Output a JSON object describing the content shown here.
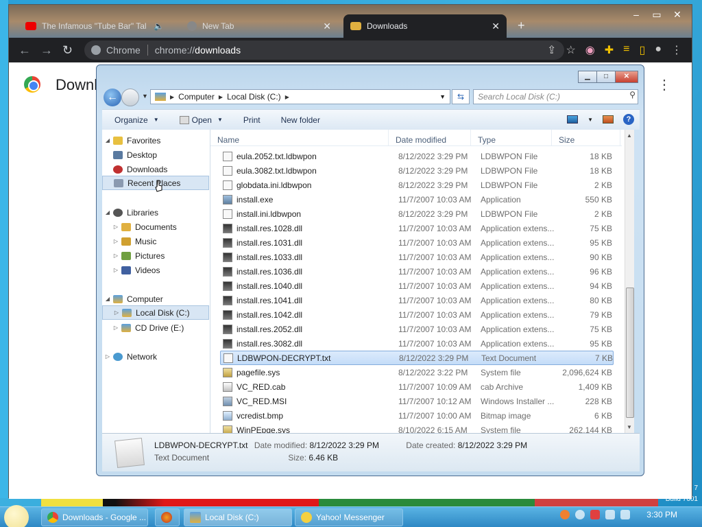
{
  "desktop": {
    "corner_text_1": "7",
    "corner_text_2": "Build 7601"
  },
  "chrome": {
    "tabs": [
      {
        "label": "The Infamous \"Tube Bar\" Tal",
        "active": false
      },
      {
        "label": "New Tab",
        "active": false
      },
      {
        "label": "Downloads",
        "active": true
      }
    ],
    "omnibox": {
      "site": "Chrome",
      "scheme": "chrome://",
      "path": "downloads"
    },
    "page_title": "Downl",
    "more_icon": "⋮"
  },
  "explorer": {
    "breadcrumb": [
      "Computer",
      "Local Disk (C:)"
    ],
    "search_placeholder": "Search Local Disk (C:)",
    "commands": {
      "organize": "Organize",
      "open": "Open",
      "print": "Print",
      "new_folder": "New folder"
    },
    "nav": {
      "favorites": "Favorites",
      "desktop": "Desktop",
      "downloads": "Downloads",
      "recent": "Recent Places",
      "libraries": "Libraries",
      "documents": "Documents",
      "music": "Music",
      "pictures": "Pictures",
      "videos": "Videos",
      "computer": "Computer",
      "local_disk": "Local Disk (C:)",
      "cd_drive": "CD Drive (E:)",
      "network": "Network"
    },
    "columns": {
      "name": "Name",
      "date": "Date modified",
      "type": "Type",
      "size": "Size"
    },
    "files": [
      {
        "name": "eula.2052.txt.ldbwpon",
        "date": "8/12/2022 3:29 PM",
        "type": "LDBWPON File",
        "size": "18 KB"
      },
      {
        "name": "eula.3082.txt.ldbwpon",
        "date": "8/12/2022 3:29 PM",
        "type": "LDBWPON File",
        "size": "18 KB"
      },
      {
        "name": "globdata.ini.ldbwpon",
        "date": "8/12/2022 3:29 PM",
        "type": "LDBWPON File",
        "size": "2 KB"
      },
      {
        "name": "install.exe",
        "date": "11/7/2007 10:03 AM",
        "type": "Application",
        "size": "550 KB"
      },
      {
        "name": "install.ini.ldbwpon",
        "date": "8/12/2022 3:29 PM",
        "type": "LDBWPON File",
        "size": "2 KB"
      },
      {
        "name": "install.res.1028.dll",
        "date": "11/7/2007 10:03 AM",
        "type": "Application extens...",
        "size": "75 KB"
      },
      {
        "name": "install.res.1031.dll",
        "date": "11/7/2007 10:03 AM",
        "type": "Application extens...",
        "size": "95 KB"
      },
      {
        "name": "install.res.1033.dll",
        "date": "11/7/2007 10:03 AM",
        "type": "Application extens...",
        "size": "90 KB"
      },
      {
        "name": "install.res.1036.dll",
        "date": "11/7/2007 10:03 AM",
        "type": "Application extens...",
        "size": "96 KB"
      },
      {
        "name": "install.res.1040.dll",
        "date": "11/7/2007 10:03 AM",
        "type": "Application extens...",
        "size": "94 KB"
      },
      {
        "name": "install.res.1041.dll",
        "date": "11/7/2007 10:03 AM",
        "type": "Application extens...",
        "size": "80 KB"
      },
      {
        "name": "install.res.1042.dll",
        "date": "11/7/2007 10:03 AM",
        "type": "Application extens...",
        "size": "79 KB"
      },
      {
        "name": "install.res.2052.dll",
        "date": "11/7/2007 10:03 AM",
        "type": "Application extens...",
        "size": "75 KB"
      },
      {
        "name": "install.res.3082.dll",
        "date": "11/7/2007 10:03 AM",
        "type": "Application extens...",
        "size": "95 KB"
      },
      {
        "name": "LDBWPON-DECRYPT.txt",
        "date": "8/12/2022 3:29 PM",
        "type": "Text Document",
        "size": "7 KB",
        "selected": true
      },
      {
        "name": "pagefile.sys",
        "date": "8/12/2022 3:22 PM",
        "type": "System file",
        "size": "2,096,624 KB"
      },
      {
        "name": "VC_RED.cab",
        "date": "11/7/2007 10:09 AM",
        "type": "cab Archive",
        "size": "1,409 KB"
      },
      {
        "name": "VC_RED.MSI",
        "date": "11/7/2007 10:12 AM",
        "type": "Windows Installer ...",
        "size": "228 KB"
      },
      {
        "name": "vcredist.bmp",
        "date": "11/7/2007 10:00 AM",
        "type": "Bitmap image",
        "size": "6 KB"
      },
      {
        "name": "WinPEpge.sys",
        "date": "8/10/2022 6:15 AM",
        "type": "System file",
        "size": "262,144 KB"
      }
    ],
    "details": {
      "name": "LDBWPON-DECRYPT.txt",
      "type": "Text Document",
      "modified_label": "Date modified:",
      "modified": "8/12/2022 3:29 PM",
      "created_label": "Date created:",
      "created": "8/12/2022 3:29 PM",
      "size_label": "Size:",
      "size": "6.46 KB"
    }
  },
  "taskbar": {
    "tasks": [
      "Downloads - Google ...",
      "Local Disk (C:)",
      "Yahoo! Messenger"
    ],
    "clock": "3:30 PM"
  }
}
